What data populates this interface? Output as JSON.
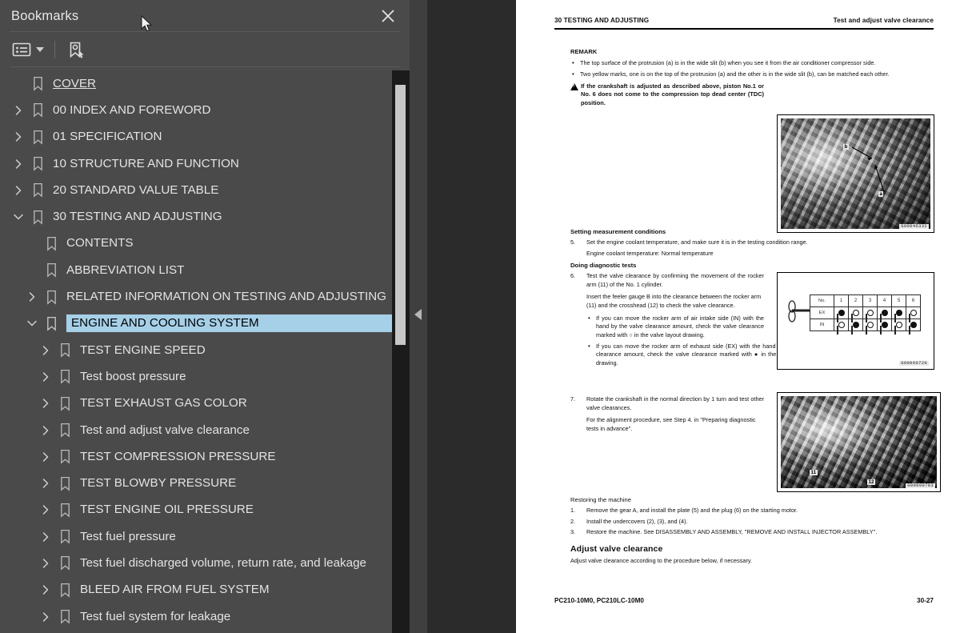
{
  "sidebar": {
    "title": "Bookmarks",
    "close_icon": "close-icon",
    "toolbar": {
      "options_label": "list-options-icon",
      "new_bookmark_label": "new-bookmark-icon"
    },
    "tree": [
      {
        "label": "COVER",
        "level": 0,
        "twisty": "none",
        "selected": false,
        "underline": true
      },
      {
        "label": "00 INDEX AND FOREWORD",
        "level": 0,
        "twisty": "collapsed",
        "selected": false
      },
      {
        "label": "01 SPECIFICATION",
        "level": 0,
        "twisty": "collapsed",
        "selected": false
      },
      {
        "label": "10 STRUCTURE AND FUNCTION",
        "level": 0,
        "twisty": "collapsed",
        "selected": false
      },
      {
        "label": "20 STANDARD VALUE TABLE",
        "level": 0,
        "twisty": "collapsed",
        "selected": false
      },
      {
        "label": "30 TESTING AND ADJUSTING",
        "level": 0,
        "twisty": "expanded",
        "selected": false
      },
      {
        "label": "CONTENTS",
        "level": 1,
        "twisty": "none",
        "selected": false
      },
      {
        "label": "ABBREVIATION LIST",
        "level": 1,
        "twisty": "none",
        "selected": false
      },
      {
        "label": "RELATED INFORMATION ON TESTING AND ADJUSTING",
        "level": 1,
        "twisty": "collapsed",
        "selected": false
      },
      {
        "label": "ENGINE AND COOLING SYSTEM",
        "level": 1,
        "twisty": "expanded",
        "selected": true
      },
      {
        "label": "TEST ENGINE SPEED",
        "level": 2,
        "twisty": "collapsed",
        "selected": false
      },
      {
        "label": "Test boost pressure",
        "level": 2,
        "twisty": "collapsed",
        "selected": false
      },
      {
        "label": "TEST EXHAUST GAS COLOR",
        "level": 2,
        "twisty": "collapsed",
        "selected": false
      },
      {
        "label": "Test and adjust valve clearance",
        "level": 2,
        "twisty": "collapsed",
        "selected": false
      },
      {
        "label": "TEST COMPRESSION PRESSURE",
        "level": 2,
        "twisty": "collapsed",
        "selected": false
      },
      {
        "label": "TEST BLOWBY PRESSURE",
        "level": 2,
        "twisty": "collapsed",
        "selected": false
      },
      {
        "label": "TEST ENGINE OIL PRESSURE",
        "level": 2,
        "twisty": "collapsed",
        "selected": false
      },
      {
        "label": "Test fuel pressure",
        "level": 2,
        "twisty": "collapsed",
        "selected": false
      },
      {
        "label": "Test fuel discharged volume, return rate, and leakage",
        "level": 2,
        "twisty": "collapsed",
        "selected": false
      },
      {
        "label": "BLEED AIR FROM FUEL SYSTEM",
        "level": 2,
        "twisty": "collapsed",
        "selected": false
      },
      {
        "label": "Test fuel system for leakage",
        "level": 2,
        "twisty": "collapsed",
        "selected": false
      }
    ]
  },
  "splitter": {
    "collapse_icon": "collapse-left-arrow-icon"
  },
  "page": {
    "header_left": "30 TESTING AND ADJUSTING",
    "header_right": "Test and adjust valve clearance",
    "remark_heading": "REMARK",
    "remark_bullets": [
      "The top surface of the protrusion (a) is in the wide slit (b) when you see it from the air conditioner compressor side.",
      "Two yellow marks, one is on the top of the protrusion (a) and the other is in the wide slit (b), can be matched each other."
    ],
    "warning": "If the crankshaft is adjusted as described above, piston No.1 or No. 6 does not come to the compression top dead center (TDC) position.",
    "section_setting": "Setting measurement conditions",
    "step5_num": "5.",
    "step5": "Set the engine coolant temperature, and make sure it is in the testing condition range.",
    "step5_sub": "Engine coolant temperature: Normal temperature",
    "section_doing": "Doing diagnostic tests",
    "step6_num": "6.",
    "step6": "Test the valve clearance by confirming the movement of the rocker arm (11) of the No. 1 cylinder.",
    "step6_p2": "Insert the feeler gauge B into the clearance between the rocker arm (11) and the crosshead (12) to check the valve clearance.",
    "step6_bullets": [
      "If you can move the rocker arm of air intake side (IN) with the hand by the valve clearance amount, check the valve clearance marked with ○ in the valve layout drawing.",
      "If you can move the rocker arm of exhaust side (EX) with the hand by the valve clearance amount, check the valve clearance marked with ● in the valve layout drawing."
    ],
    "step7_num": "7.",
    "step7": "Rotate the crankshaft in the normal direction by 1 turn and test other valve clearances.",
    "step7_p2": "For the alignment procedure, see Step 4. in \"Preparing diagnostic tests in advance\".",
    "section_restoring": "Restoring the machine",
    "restoring": [
      {
        "n": "1.",
        "text": "Remove the gear A, and install the plate (5) and the plug (6) on the starting motor."
      },
      {
        "n": "2.",
        "text": "Install the undercovers (2), (3), and (4)."
      },
      {
        "n": "3.",
        "text": "Restore the machine. See DISASSEMBLY AND ASSEMBLY, \"REMOVE AND INSTALL INJECTOR ASSEMBLY\"."
      }
    ],
    "adjust_heading": "Adjust valve clearance",
    "adjust_text": "Adjust valve clearance according to the procedure below, if necessary.",
    "footer_left": "PC210-10M0, PC210LC-10M0",
    "footer_right": "30-27",
    "figures": [
      {
        "name": "crankshaft-protrusion-photo",
        "id": "G00046332",
        "callouts": [
          "a",
          "b"
        ]
      },
      {
        "name": "valve-layout-drawing",
        "id": "G00000720",
        "callouts": []
      },
      {
        "name": "rocker-arm-photo",
        "id": "G00000783",
        "callouts": [
          "11",
          "12"
        ]
      }
    ],
    "valve_table": {
      "row_header": [
        "No.",
        "EX",
        "IN"
      ],
      "columns": [
        "1",
        "2",
        "3",
        "4",
        "5",
        "6"
      ],
      "ex": [
        "filled",
        "open",
        "open",
        "filled",
        "filled",
        "open"
      ],
      "in": [
        "open",
        "filled",
        "open",
        "filled",
        "open",
        "filled"
      ]
    }
  },
  "colors": {
    "sidebar_bg": "#4a4a4a",
    "viewer_bg": "#2b2b2b",
    "selection": "#a6d0e8",
    "page_bg": "#ffffff"
  }
}
